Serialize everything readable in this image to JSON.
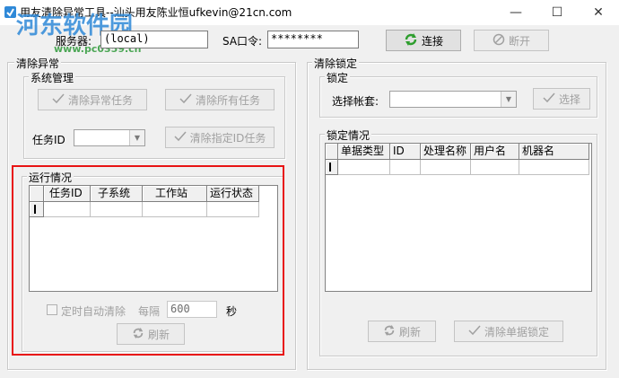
{
  "window": {
    "title": "用友清除异常工具--汕头用友陈业恒ufkevin@21cn.com",
    "minimize": "—",
    "maximize": "☐",
    "close": "✕"
  },
  "watermark": {
    "text": "河东软件园",
    "url": "www.pc0359.cn"
  },
  "connection": {
    "server_label": "服务器:",
    "server_value": "(local)",
    "sa_label": "SA口令:",
    "sa_value": "********",
    "connect_label": "连接",
    "disconnect_label": "断开"
  },
  "clear_exception": {
    "group_title": "清除异常",
    "sys_group_title": "系统管理",
    "clear_exception_tasks": "清除异常任务",
    "clear_all_tasks": "清除所有任务",
    "task_id_label": "任务ID",
    "task_id_value": "",
    "clear_specified_task": "清除指定ID任务",
    "run_group_title": "运行情况",
    "run_columns": [
      "任务ID",
      "子系统",
      "工作站",
      "运行状态"
    ],
    "auto_clear_label": "定时自动清除",
    "interval_label": "每隔",
    "interval_value": "600",
    "seconds_label": "秒",
    "refresh_label": "刷新"
  },
  "clear_lock": {
    "group_title": "清除锁定",
    "lock_group_title": "锁定",
    "account_label": "选择帐套:",
    "account_value": "",
    "select_label": "选择",
    "lock_info_title": "锁定情况",
    "lock_columns": [
      "单据类型",
      "ID",
      "处理名称",
      "用户名",
      "机器名"
    ],
    "refresh_label": "刷新",
    "clear_lock_label": "清除单据锁定"
  },
  "colors": {
    "highlight": "#e81414",
    "connect_icon": "#2e9e2e",
    "watermark": "#2f89d8"
  }
}
